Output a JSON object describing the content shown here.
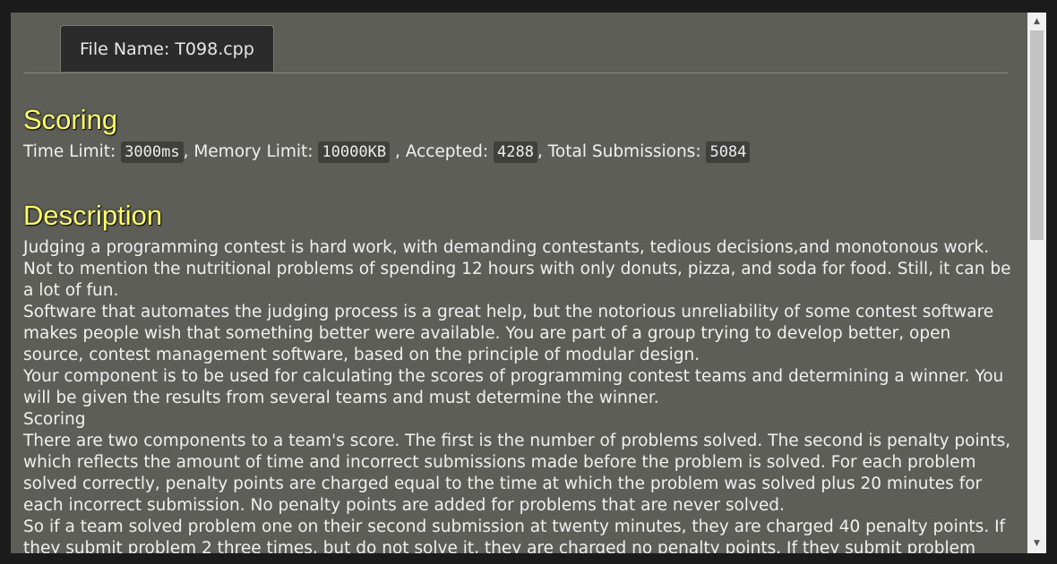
{
  "tab": {
    "label": "File Name:  T098.cpp"
  },
  "scoring": {
    "title": "Scoring",
    "time_limit_label": "Time Limit:",
    "time_limit_value": "3000ms",
    "memory_limit_label": ", Memory Limit:",
    "memory_limit_value": "10000KB",
    "accepted_label": " , Accepted:",
    "accepted_value": "4288",
    "total_label": ", Total Submissions:",
    "total_value": "5084"
  },
  "description": {
    "title": "Description",
    "paragraphs": [
      "Judging a programming contest is hard work, with demanding contestants, tedious decisions,and monotonous work. Not to mention the nutritional problems of spending 12 hours with only donuts, pizza, and soda for food. Still, it can be a lot of fun.",
      "Software that automates the judging process is a great help, but the notorious unreliability of some contest software makes people wish that something better were available. You are part of a group trying to develop better, open source, contest management software, based on the principle of modular design.",
      "Your component is to be used for calculating the scores of programming contest teams and determining a winner. You will be given the results from several teams and must determine the winner.",
      "Scoring",
      "There are two components to a team's score. The first is the number of problems solved. The second is penalty points, which reflects the amount of time and incorrect submissions made before the problem is solved. For each problem solved correctly, penalty points are charged equal to the time at which the problem was solved plus 20 minutes for each incorrect submission. No penalty points are added for problems that are never solved.",
      "So if a team solved problem one on their second submission at twenty minutes, they are charged 40 penalty points. If they submit problem 2 three times, but do not solve it, they are charged no penalty points. If they submit problem"
    ]
  },
  "scrollbar": {
    "up_icon": "triangle-up",
    "down_icon": "triangle-down",
    "position": 0.0
  }
}
